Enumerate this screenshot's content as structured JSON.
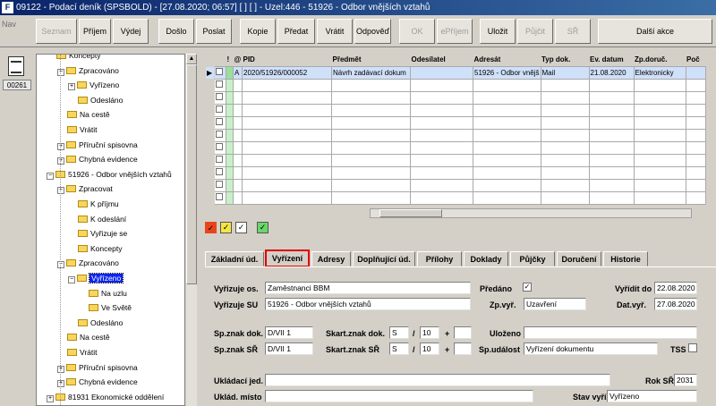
{
  "window": {
    "title": "09122 - Podací deník (SPSBOLD) - [27.08.2020; 06:57]  [ ]  [ ] - Uzel:446 - 51926 - Odbor vnějších vztahů",
    "app_icon": "app-logo-icon"
  },
  "toolbar": {
    "nav": "Nav",
    "buttons": {
      "seznam": "Seznam",
      "prijem": "Příjem",
      "vydej": "Výdej",
      "doslo": "Došlo",
      "poslat": "Poslat",
      "kopie": "Kopie",
      "predat": "Předat",
      "vratit": "Vrátit",
      "odpoved": "Odpověď",
      "ok": "OK",
      "eprijem": "ePříjem",
      "ulozit": "Uložit",
      "pujcit": "Půjčit",
      "sr": "SŘ",
      "dalsi": "Další akce"
    }
  },
  "left": {
    "badge": "00261",
    "icon": "document-icon"
  },
  "tree": [
    {
      "label": "Koncepty"
    },
    {
      "label": "Zpracováno"
    },
    {
      "label": "Vyřízeno"
    },
    {
      "label": "Odesláno"
    },
    {
      "label": "Na cestě"
    },
    {
      "label": "Vrátit"
    },
    {
      "label": "Příruční spisovna"
    },
    {
      "label": "Chybná evidence"
    },
    {
      "label": "51926 - Odbor vnějších vztahů"
    },
    {
      "label": "Zpracovat"
    },
    {
      "label": "K příjmu"
    },
    {
      "label": "K odeslání"
    },
    {
      "label": "Vyřizuje se"
    },
    {
      "label": "Koncepty"
    },
    {
      "label": "Zpracováno"
    },
    {
      "label": "Vyřízeno"
    },
    {
      "label": "Na uzlu"
    },
    {
      "label": "Ve Světě"
    },
    {
      "label": "Odesláno"
    },
    {
      "label": "Na cestě"
    },
    {
      "label": "Vrátit"
    },
    {
      "label": "Příruční spisovna"
    },
    {
      "label": "Chybná evidence"
    },
    {
      "label": "81931 Ekonomické oddělení"
    }
  ],
  "grid": {
    "headers": {
      "excl": "!",
      "clip": "@",
      "pid": "PID",
      "predmet": "Předmět",
      "odesilatel": "Odesílatel",
      "adresat": "Adresát",
      "typdok": "Typ dok.",
      "evdatum": "Ev. datum",
      "zpdoruc": "Zp.doruč.",
      "poc": "Poč"
    },
    "row": {
      "flag": "A",
      "pid": "2020/51926/000052",
      "predmet": "Návrh zadávací dokum",
      "odesilatel": "",
      "adresat": "51926 - Odbor vnějš",
      "typdok": "Mail",
      "evdatum": "21.08.2020",
      "zpdoruc": "Elektronicky"
    }
  },
  "filters": {
    "colors": [
      "#e8441c",
      "#f4e640",
      "#ffffff",
      "#68d668"
    ]
  },
  "tabs": [
    "Základní úd.",
    "Vyřízení",
    "Adresy",
    "Doplňující úd.",
    "Přílohy",
    "Doklady",
    "Půjčky",
    "Doručení",
    "Historie"
  ],
  "vyrizeni": {
    "vyrizuje_os_label": "Vyřizuje os.",
    "vyrizuje_os": "Zaměstnanci BBM",
    "vyrizuje_su_label": "Vyřizuje SU",
    "vyrizuje_su": "51926 - Odbor vnějších vztahů",
    "predano_label": "Předáno",
    "vyridit_do_label": "Vyřídit do",
    "vyridit_do": "22.08.2020",
    "zp_vyr_label": "Zp.vyř.",
    "zp_vyr": "Uzavření",
    "dat_vyr_label": "Dat.vyř.",
    "dat_vyr": "27.08.2020",
    "spznak_dok_label": "Sp.znak dok.",
    "spznak_dok": "D/VII 1",
    "skart_dok_label": "Skart.znak dok.",
    "skart_dok_s": "S",
    "skart_dok_n": "10",
    "plus": "+",
    "slash": "/",
    "spznak_sr_label": "Sp.znak SŘ",
    "spznak_sr": "D/VII 1",
    "skart_sr_label": "Skart.znak SŘ",
    "skart_sr_s": "S",
    "skart_sr_n": "10",
    "ulozeno_label": "Uloženo",
    "spudalost_label": "Sp.událost",
    "spudalost": "Vyřízení dokumentu",
    "tss_label": "TSS",
    "ukladaci_label": "Ukládací jed.",
    "rok_sr_label": "Rok SŘ",
    "rok_sr": "2031",
    "uklad_misto_label": "Uklád. místo",
    "stav_label": "Stav vyříz.",
    "stav": "Vyřízeno"
  }
}
